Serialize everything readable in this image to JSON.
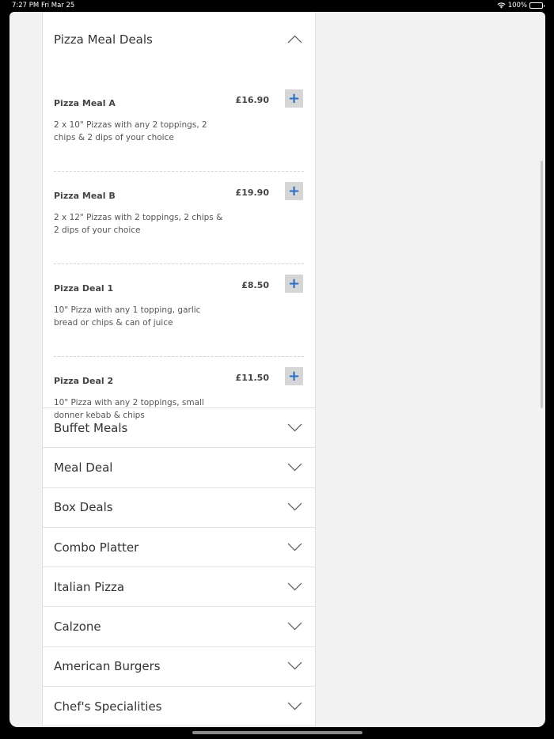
{
  "status": {
    "time": "7:27 PM  Fri Mar 25",
    "battery": "100%",
    "colors": {
      "accent": "#2b6cc4"
    }
  },
  "expanded_section": {
    "title": "Pizza Meal Deals",
    "deals": [
      {
        "name": "Pizza Meal A",
        "price": "£16.90",
        "description": "2 x 10\" Pizzas with any 2 toppings, 2 chips & 2 dips of your choice",
        "add": "+"
      },
      {
        "name": "Pizza Meal B",
        "price": "£19.90",
        "description": "2 x 12\" Pizzas with 2 toppings, 2 chips & 2 dips of your choice",
        "add": "+"
      },
      {
        "name": "Pizza Deal 1",
        "price": "£8.50",
        "description": "10\" Pizza with any 1 topping, garlic bread or chips & can of juice",
        "add": "+"
      },
      {
        "name": "Pizza Deal 2",
        "price": "£11.50",
        "description": "10\" Pizza with any 2 toppings, small donner kebab & chips",
        "add": "+"
      }
    ]
  },
  "categories": [
    "Buffet Meals",
    "Meal Deal",
    "Box Deals",
    "Combo Platter",
    "Italian Pizza",
    "Calzone",
    "American Burgers",
    "Chef's Specialities"
  ]
}
